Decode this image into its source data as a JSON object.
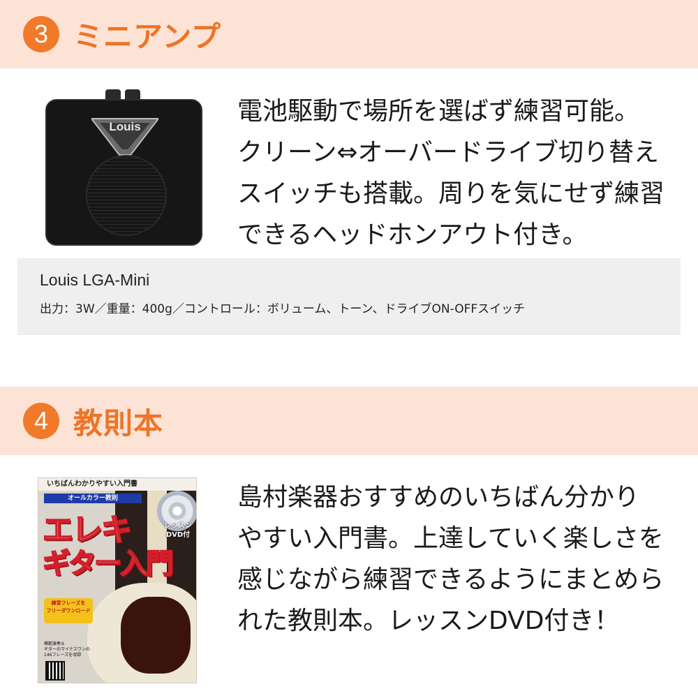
{
  "section3": {
    "number": "3",
    "title": "ミニアンプ",
    "description_lines": [
      "電池駆動で場所を選ばず練習可能。",
      "クリーン⇔オーバードライブ切り替え",
      "スイッチも搭載。周りを気にせず練習",
      "できるヘッドホンアウト付き。"
    ],
    "product_image": {
      "logo_text": "Louis"
    },
    "spec": {
      "name": "Louis LGA-Mini",
      "detail": "出力：3W／重量：400g／コントロール：ボリューム、トーン、ドライブON-OFFスイッチ"
    }
  },
  "section4": {
    "number": "4",
    "title": "教則本",
    "description_lines": [
      "島村楽器おすすめのいちばん分かり",
      "やすい入門書。上達していく楽しさを",
      "感じながら練習できるようにまとめら",
      "れた教則本。レッスンDVD付き！"
    ],
    "book_cover": {
      "top_text": "いちばんわかりやすい入門書",
      "band_text": "オールカラー教則",
      "title_line1": "エレキ",
      "title_line2": "ギター入門",
      "dvd_text": "レッスン\nDVD付",
      "badge_text": "練習フレーズを\nフリーダウンロード",
      "foot_text": "模範演奏＆\nギターのマイナスワンの\n146フレーズを収録"
    }
  },
  "colors": {
    "header_bg": "#fde3d6",
    "accent": "#f07a2a",
    "title": "#ee7427",
    "spec_bg": "#efefef"
  }
}
